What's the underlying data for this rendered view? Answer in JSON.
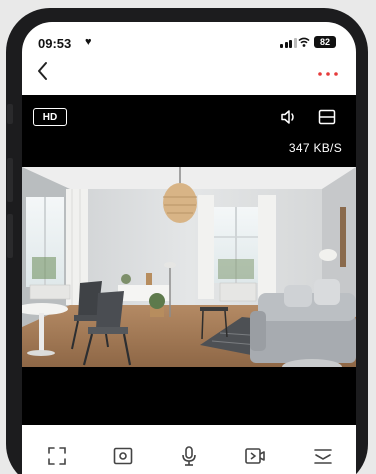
{
  "status_bar": {
    "time": "09:53",
    "heart": "♥",
    "battery": "82"
  },
  "nav": {
    "back_icon": "chevron-left-icon",
    "more_icon": "more-dots-icon",
    "more_color": "#e63b3b"
  },
  "video": {
    "quality_label": "HD",
    "bitrate": "347 KB/S",
    "speaker_icon": "speaker-icon",
    "layout_icon": "layout-toggle-icon"
  },
  "controls": [
    {
      "name": "fullscreen-icon"
    },
    {
      "name": "snapshot-icon"
    },
    {
      "name": "microphone-icon"
    },
    {
      "name": "record-video-icon"
    },
    {
      "name": "menu-icon"
    }
  ]
}
